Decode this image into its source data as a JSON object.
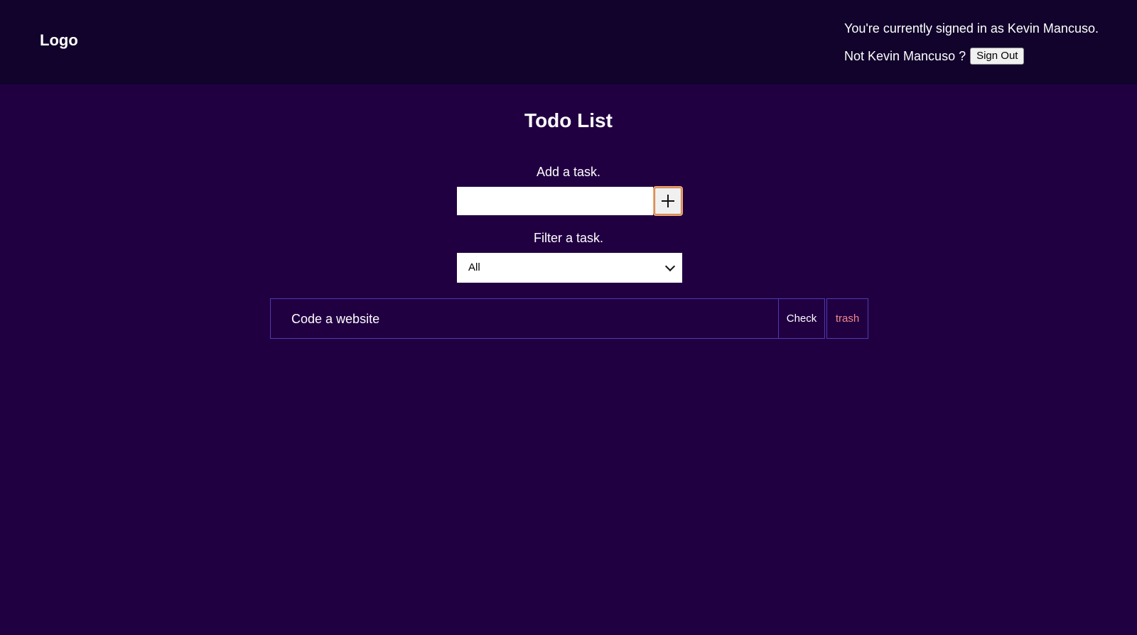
{
  "header": {
    "logo": "Logo",
    "signed_in_text": "You're currently signed in as Kevin Mancuso.",
    "not_user_text": "Not Kevin Mancuso ?",
    "sign_out_label": "Sign Out"
  },
  "main": {
    "title": "Todo List",
    "add_label": "Add a task.",
    "add_input_value": "",
    "add_button_icon": "plus-icon",
    "filter_label": "Filter a task.",
    "filter_selected": "All",
    "tasks": [
      {
        "text": "Code a website",
        "check_label": "Check",
        "trash_label": "trash"
      }
    ]
  },
  "colors": {
    "page_background": "#210042",
    "header_background": "#11032b",
    "task_border": "#4c3bb0",
    "trash_text": "#f28a8a",
    "add_button_border": "#f0a46a"
  }
}
